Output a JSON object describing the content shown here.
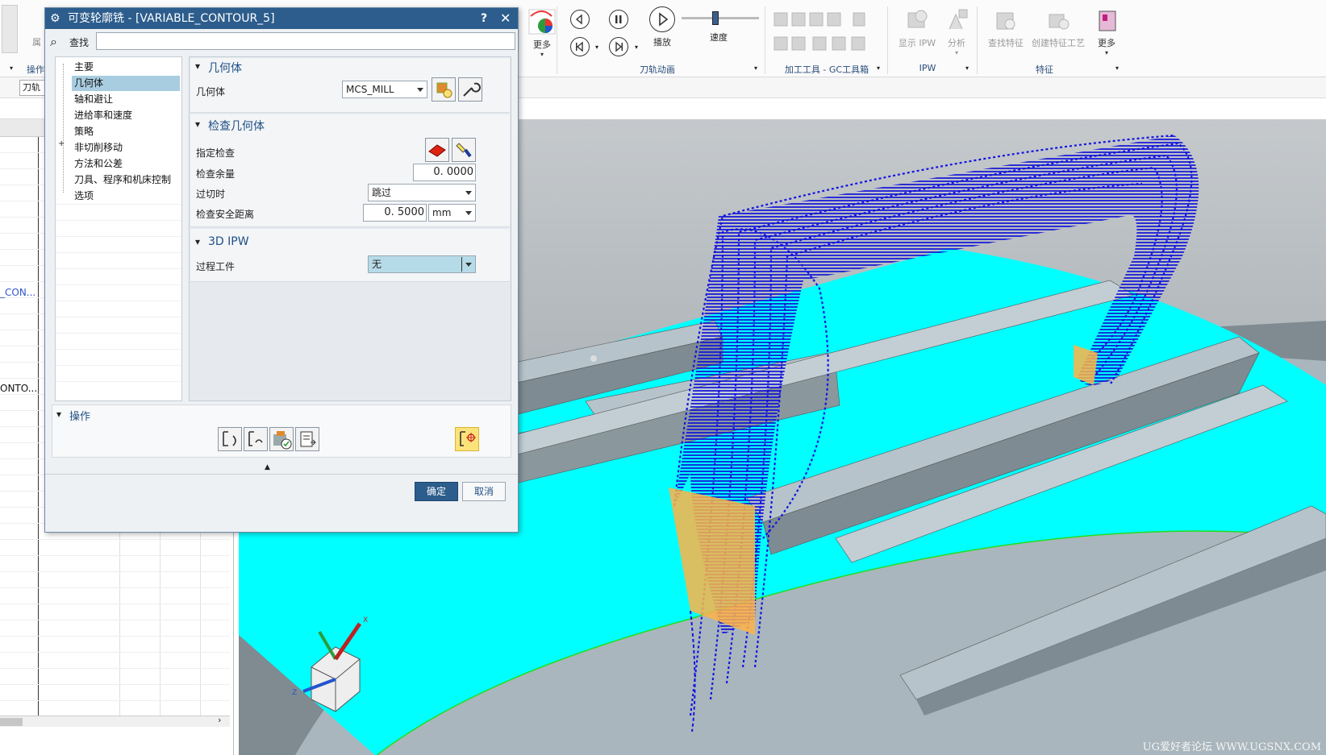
{
  "ribbon": {
    "more1": "更多",
    "play": "播放",
    "speed": "速度",
    "group_animation": "刀轨动画",
    "group_tools": "加工工具 - GC工具箱",
    "display_ipw": "显示 IPW",
    "analyze": "分析",
    "group_ipw": "IPW",
    "find_feature": "查找特征",
    "create_feature_process": "创建特征工艺",
    "more2": "更多",
    "group_feature": "特征",
    "left_group1": "操作",
    "left_label": "属",
    "toolpath_tab": "刀轨"
  },
  "nav": {
    "row_var1": "_CON...",
    "row_var2": "ONTO..."
  },
  "dialog": {
    "title": "可变轮廓铣 - [VARIABLE_CONTOUR_5]",
    "help": "?",
    "close": "✕",
    "find_label": "查找",
    "find_value": "",
    "tree": [
      "主要",
      "几何体",
      "轴和避让",
      "进给率和速度",
      "策略",
      "非切削移动",
      "方法和公差",
      "刀具、程序和机床控制",
      "选项"
    ],
    "tree_selected": 1,
    "sec_geometry": "几何体",
    "geometry_label": "几何体",
    "geometry_value": "MCS_MILL",
    "sec_check": "检查几何体",
    "specify_check": "指定检查",
    "check_stock": "检查余量",
    "check_stock_value": "0. 0000",
    "on_gouge": "过切时",
    "on_gouge_value": "跳过",
    "check_clearance": "检查安全距离",
    "check_clearance_value": "0. 5000",
    "clearance_unit": "mm",
    "sec_ipw": "3D IPW",
    "process_workpiece": "过程工件",
    "process_workpiece_value": "无",
    "sec_actions": "操作",
    "ok": "确定",
    "cancel": "取消"
  },
  "watermark": "UG爱好者论坛 WWW.UGSNX.COM",
  "colors": {
    "title_bar": "#2c5d8c",
    "section_text": "#1f4f86",
    "ok_button": "#2c5d8c",
    "toolpath": "#1515e0",
    "surface": "#00ffff",
    "part": "#9aa7ae"
  }
}
